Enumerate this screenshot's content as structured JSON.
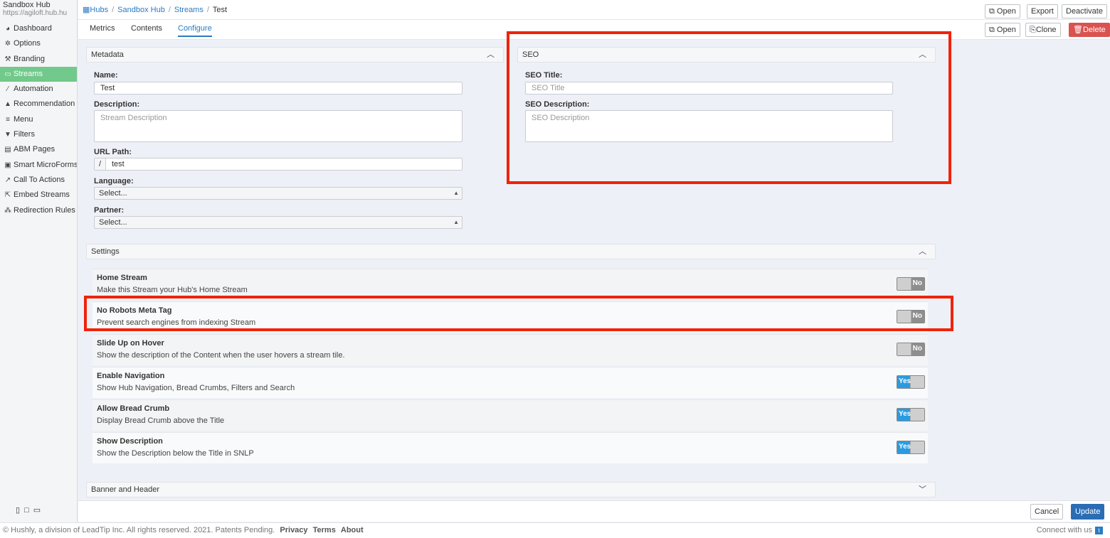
{
  "sidebar": {
    "hub_name": "Sandbox Hub",
    "hub_url": "https://agiloft.hub.hu",
    "items": [
      {
        "label": "Dashboard",
        "icon": "dashboard-icon"
      },
      {
        "label": "Options",
        "icon": "gear-icon"
      },
      {
        "label": "Branding",
        "icon": "wrench-icon"
      },
      {
        "label": "Streams",
        "icon": "streams-icon",
        "active": true
      },
      {
        "label": "Automation",
        "icon": "magic-wand-icon"
      },
      {
        "label": "Recommendation",
        "icon": "thumbs-up-icon"
      },
      {
        "label": "Menu",
        "icon": "menu-icon"
      },
      {
        "label": "Filters",
        "icon": "filter-icon"
      },
      {
        "label": "ABM Pages",
        "icon": "page-icon"
      },
      {
        "label": "Smart MicroForms",
        "icon": "form-icon"
      },
      {
        "label": "Call To Actions",
        "icon": "external-link-icon"
      },
      {
        "label": "Embed Streams",
        "icon": "embed-icon"
      },
      {
        "label": "Redirection Rules",
        "icon": "sitemap-icon"
      }
    ]
  },
  "breadcrumb": {
    "hubs": "Hubs",
    "hub": "Sandbox Hub",
    "streams": "Streams",
    "current": "Test"
  },
  "tabs": {
    "metrics": "Metrics",
    "contents": "Contents",
    "configure": "Configure"
  },
  "top_actions": {
    "open": "Open",
    "export": "Export",
    "deactivate": "Deactivate",
    "open2": "Open",
    "clone": "Clone",
    "delete": "Delete"
  },
  "metadata": {
    "header": "Metadata",
    "name_label": "Name:",
    "name_value": "Test",
    "description_label": "Description:",
    "description_placeholder": "Stream Description",
    "url_label": "URL Path:",
    "url_prefix": "/",
    "url_value": "test",
    "language_label": "Language:",
    "language_value": "Select...",
    "partner_label": "Partner:",
    "partner_value": "Select..."
  },
  "seo": {
    "header": "SEO",
    "title_label": "SEO Title:",
    "title_placeholder": "SEO Title",
    "description_label": "SEO Description:",
    "description_placeholder": "SEO Description"
  },
  "settings": {
    "header": "Settings",
    "rows": [
      {
        "title": "Home Stream",
        "desc": "Make this Stream your Hub's Home Stream",
        "state": "No"
      },
      {
        "title": "No Robots Meta Tag",
        "desc": "Prevent search engines from indexing Stream",
        "state": "No"
      },
      {
        "title": "Slide Up on Hover",
        "desc": "Show the description of the Content when the user hovers a stream tile.",
        "state": "No"
      },
      {
        "title": "Enable Navigation",
        "desc": "Show Hub Navigation, Bread Crumbs, Filters and Search",
        "state": "Yes"
      },
      {
        "title": "Allow Bread Crumb",
        "desc": "Display Bread Crumb above the Title",
        "state": "Yes"
      },
      {
        "title": "Show Description",
        "desc": "Show the Description below the Title in SNLP",
        "state": "Yes"
      }
    ]
  },
  "banner": {
    "header": "Banner and Header"
  },
  "actions": {
    "cancel": "Cancel",
    "update": "Update"
  },
  "footer": {
    "copyright": "© Hushly, a division of LeadTip Inc. All rights reserved. 2021. Patents Pending.",
    "privacy": "Privacy",
    "terms": "Terms",
    "about": "About",
    "connect": "Connect with us"
  },
  "colors": {
    "accent": "#2a7bc3",
    "active_nav": "#71c98b",
    "delete": "#d9534f",
    "update": "#2a6db5",
    "highlight": "#f0230a"
  }
}
